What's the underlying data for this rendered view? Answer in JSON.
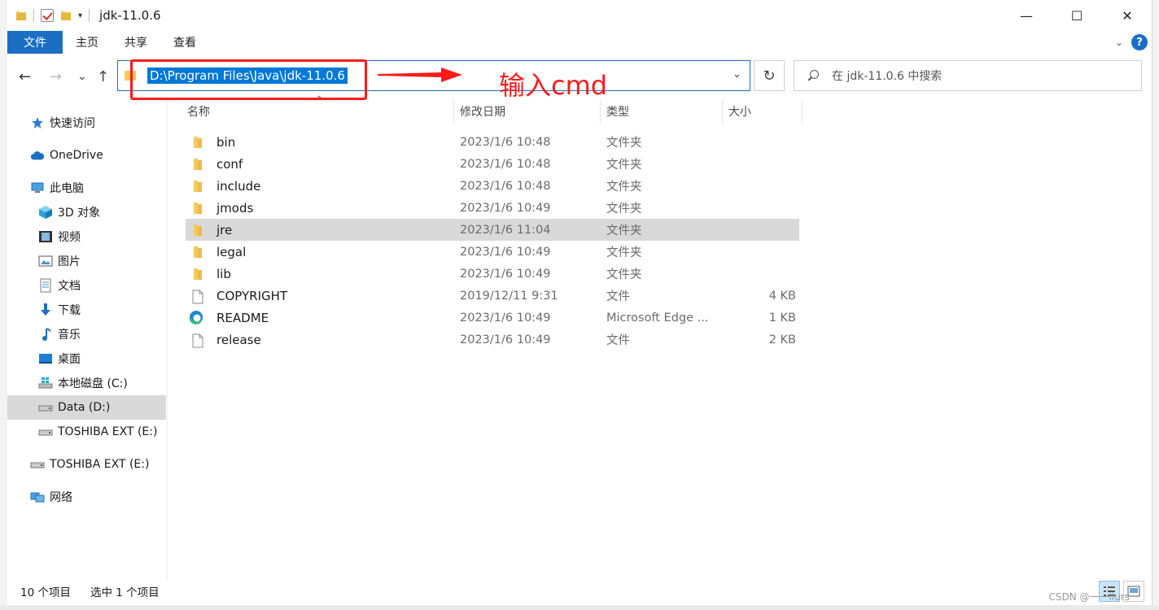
{
  "window": {
    "title": "jdk-11.0.6",
    "controls": {
      "minimize": "—",
      "maximize": "☐",
      "close": "✕"
    }
  },
  "ribbon": {
    "tabs": [
      {
        "label": "文件",
        "active": true
      },
      {
        "label": "主页"
      },
      {
        "label": "共享"
      },
      {
        "label": "查看"
      }
    ],
    "help": "?"
  },
  "nav": {
    "back": "←",
    "forward": "→",
    "recent": "⌄",
    "up": "↑",
    "address": "D:\\Program Files\\Java\\jdk-11.0.6",
    "refresh": "↻",
    "search_placeholder": "在 jdk-11.0.6 中搜索"
  },
  "annotation": {
    "text": "输入cmd",
    "color": "#ff1a1a"
  },
  "sidebar": {
    "items": [
      {
        "label": "快速访问",
        "icon": "star-icon",
        "indent": 0
      },
      {
        "label": "OneDrive",
        "icon": "cloud-icon",
        "indent": 0
      },
      {
        "label": "此电脑",
        "icon": "computer-icon",
        "indent": 0
      },
      {
        "label": "3D 对象",
        "icon": "cube-icon",
        "indent": 1
      },
      {
        "label": "视频",
        "icon": "video-icon",
        "indent": 1
      },
      {
        "label": "图片",
        "icon": "picture-icon",
        "indent": 1
      },
      {
        "label": "文档",
        "icon": "document-icon",
        "indent": 1
      },
      {
        "label": "下载",
        "icon": "download-icon",
        "indent": 1
      },
      {
        "label": "音乐",
        "icon": "music-icon",
        "indent": 1
      },
      {
        "label": "桌面",
        "icon": "desktop-icon",
        "indent": 1
      },
      {
        "label": "本地磁盘 (C:)",
        "icon": "windows-drive-icon",
        "indent": 1
      },
      {
        "label": "Data (D:)",
        "icon": "drive-icon",
        "indent": 1,
        "selected": true
      },
      {
        "label": "TOSHIBA EXT (E:)",
        "icon": "drive-icon",
        "indent": 1
      },
      {
        "label": "TOSHIBA EXT (E:)",
        "icon": "drive-icon",
        "indent": 0
      },
      {
        "label": "网络",
        "icon": "network-icon",
        "indent": 0
      }
    ]
  },
  "columns": {
    "name": "名称",
    "date": "修改日期",
    "type": "类型",
    "size": "大小"
  },
  "files": [
    {
      "name": "bin",
      "date": "2023/1/6 10:48",
      "type": "文件夹",
      "size": "",
      "icon": "folder-icon"
    },
    {
      "name": "conf",
      "date": "2023/1/6 10:48",
      "type": "文件夹",
      "size": "",
      "icon": "folder-icon"
    },
    {
      "name": "include",
      "date": "2023/1/6 10:48",
      "type": "文件夹",
      "size": "",
      "icon": "folder-icon"
    },
    {
      "name": "jmods",
      "date": "2023/1/6 10:49",
      "type": "文件夹",
      "size": "",
      "icon": "folder-icon"
    },
    {
      "name": "jre",
      "date": "2023/1/6 11:04",
      "type": "文件夹",
      "size": "",
      "icon": "folder-icon",
      "selected": true
    },
    {
      "name": "legal",
      "date": "2023/1/6 10:49",
      "type": "文件夹",
      "size": "",
      "icon": "folder-icon"
    },
    {
      "name": "lib",
      "date": "2023/1/6 10:49",
      "type": "文件夹",
      "size": "",
      "icon": "folder-icon"
    },
    {
      "name": "COPYRIGHT",
      "date": "2019/12/11 9:31",
      "type": "文件",
      "size": "4 KB",
      "icon": "file-icon"
    },
    {
      "name": "README",
      "date": "2023/1/6 10:49",
      "type": "Microsoft Edge ...",
      "size": "1 KB",
      "icon": "edge-icon"
    },
    {
      "name": "release",
      "date": "2023/1/6 10:49",
      "type": "文件",
      "size": "2 KB",
      "icon": "file-icon"
    }
  ],
  "status": {
    "count": "10 个项目",
    "selection": "选中 1 个项目"
  },
  "watermark": "CSDN @一一llurs",
  "colors": {
    "accent": "#1a6fc4",
    "selection": "#0078d7",
    "row_selected": "#d9d9d9",
    "folder": "#f4c95d"
  }
}
